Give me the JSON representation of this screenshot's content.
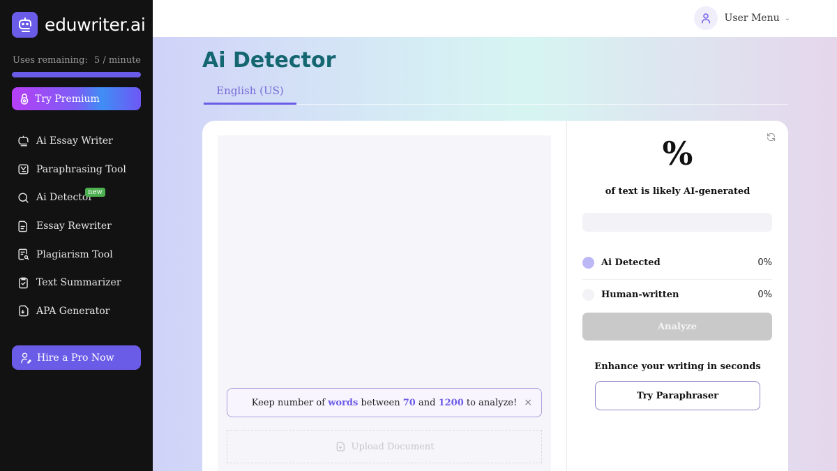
{
  "brand": {
    "name": "eduwriter.ai",
    "accent": "#6b5ce7"
  },
  "sidebar": {
    "uses_label": "Uses remaining:",
    "uses_value": "5 / minute",
    "uses_fraction": 1.0,
    "premium_label": "Try Premium",
    "items": [
      {
        "label": "Ai Essay Writer",
        "icon": "robot-icon"
      },
      {
        "label": "Paraphrasing Tool",
        "icon": "paraphrase-icon"
      },
      {
        "label": "Ai Detector",
        "icon": "search-icon",
        "badge": "new"
      },
      {
        "label": "Essay Rewriter",
        "icon": "document-icon"
      },
      {
        "label": "Plagiarism Tool",
        "icon": "document-search-icon"
      },
      {
        "label": "Text Summarizer",
        "icon": "clipboard-check-icon"
      },
      {
        "label": "APA Generator",
        "icon": "file-icon"
      }
    ],
    "hire_label": "Hire a Pro Now"
  },
  "topbar": {
    "user_menu_label": "User Menu"
  },
  "main": {
    "title": "Ai Detector",
    "tabs": [
      {
        "label": "English (US)",
        "active": true
      }
    ],
    "notice": {
      "prefix": "Keep number of",
      "words": "words",
      "between": "between",
      "min": "70",
      "and": "and",
      "max": "1200",
      "suffix": "to analyze!",
      "close": "×"
    },
    "upload_label": "Upload Document",
    "result": {
      "percent_symbol": "%",
      "subtitle": "of text is likely AI-generated",
      "ai_fraction": 0,
      "rows": [
        {
          "label": "Ai Detected",
          "value": "0%",
          "color": "#bcb8f5"
        },
        {
          "label": "Human-written",
          "value": "0%",
          "color": "#f2f2f7"
        }
      ],
      "analyze_label": "Analyze",
      "enhance_text": "Enhance your writing in seconds",
      "paraphraser_label": "Try Paraphraser"
    }
  }
}
